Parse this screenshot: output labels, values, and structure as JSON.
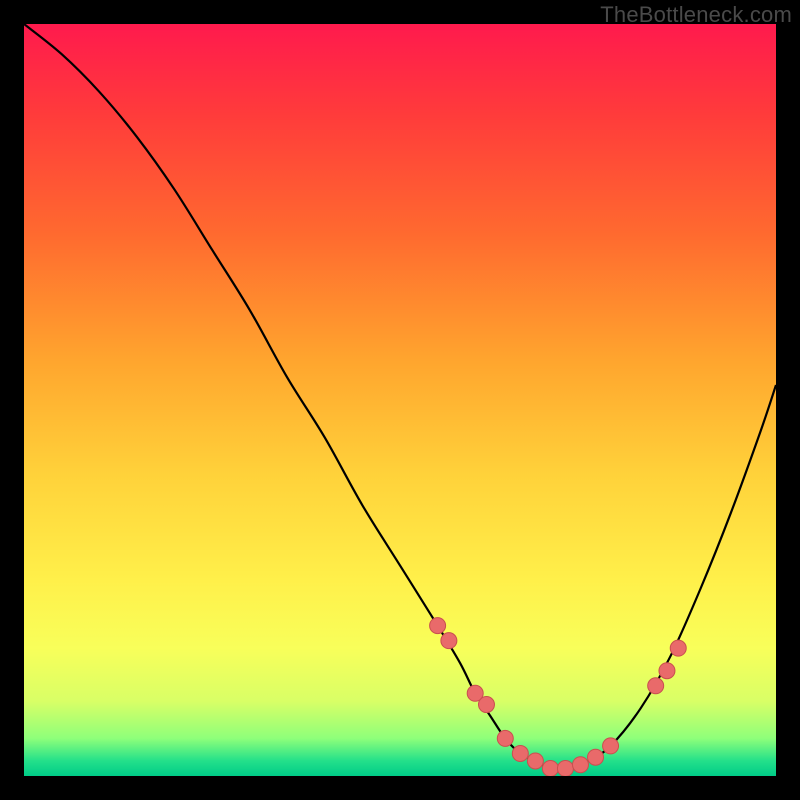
{
  "watermark": "TheBottleneck.com",
  "colors": {
    "curve_stroke": "#000000",
    "marker_fill": "#e96a6a",
    "marker_stroke": "#c94f4f"
  },
  "chart_data": {
    "type": "line",
    "title": "",
    "xlabel": "",
    "ylabel": "",
    "xlim": [
      0,
      100
    ],
    "ylim": [
      0,
      100
    ],
    "grid": false,
    "curve": {
      "x": [
        0,
        5,
        10,
        15,
        20,
        25,
        30,
        35,
        40,
        45,
        50,
        55,
        58,
        60,
        62,
        64,
        66,
        68,
        70,
        72,
        75,
        78,
        82,
        86,
        90,
        94,
        98,
        100
      ],
      "y": [
        100,
        96,
        91,
        85,
        78,
        70,
        62,
        53,
        45,
        36,
        28,
        20,
        15,
        11,
        8,
        5,
        3,
        2,
        1,
        1,
        2,
        4,
        9,
        16,
        25,
        35,
        46,
        52
      ]
    },
    "markers": {
      "x": [
        55,
        56.5,
        60,
        61.5,
        64,
        66,
        68,
        70,
        72,
        74,
        76,
        78,
        84,
        85.5,
        87
      ],
      "y": [
        20,
        18,
        11,
        9.5,
        5,
        3,
        2,
        1,
        1,
        1.5,
        2.5,
        4,
        12,
        14,
        17
      ]
    }
  }
}
